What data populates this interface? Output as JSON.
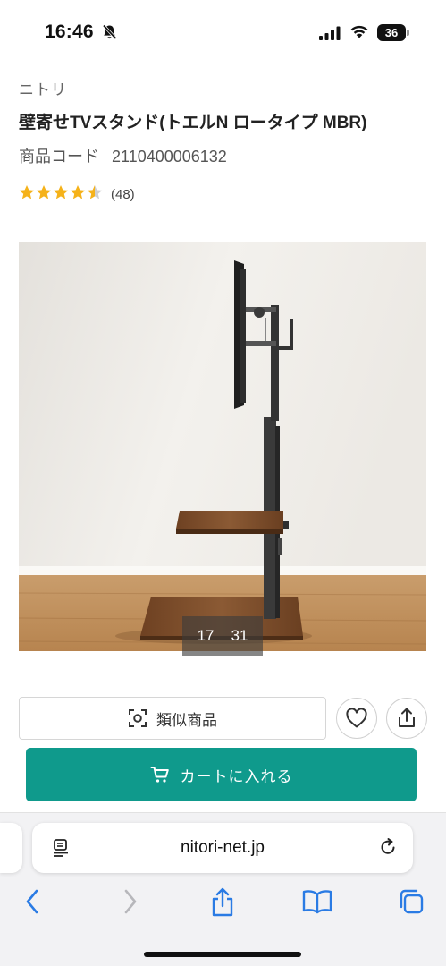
{
  "status_bar": {
    "time": "16:46",
    "battery": "36"
  },
  "product": {
    "brand": "ニトリ",
    "title": "壁寄せTVスタンド(トエルN ロータイプ MBR)",
    "code_label": "商品コード",
    "code_value": "2110400006132",
    "rating_value": 4.5,
    "rating_count": "(48)",
    "star_color": "#f5b21a"
  },
  "gallery": {
    "current": "17",
    "total": "31"
  },
  "actions": {
    "similar_label": "類似商品",
    "cart_label": "カートに入れる",
    "cart_color": "#0f9a8c"
  },
  "browser": {
    "url": "nitori-net.jp",
    "icons": [
      "back-icon",
      "forward-icon",
      "share-icon",
      "bookmarks-icon",
      "tabs-icon"
    ]
  }
}
